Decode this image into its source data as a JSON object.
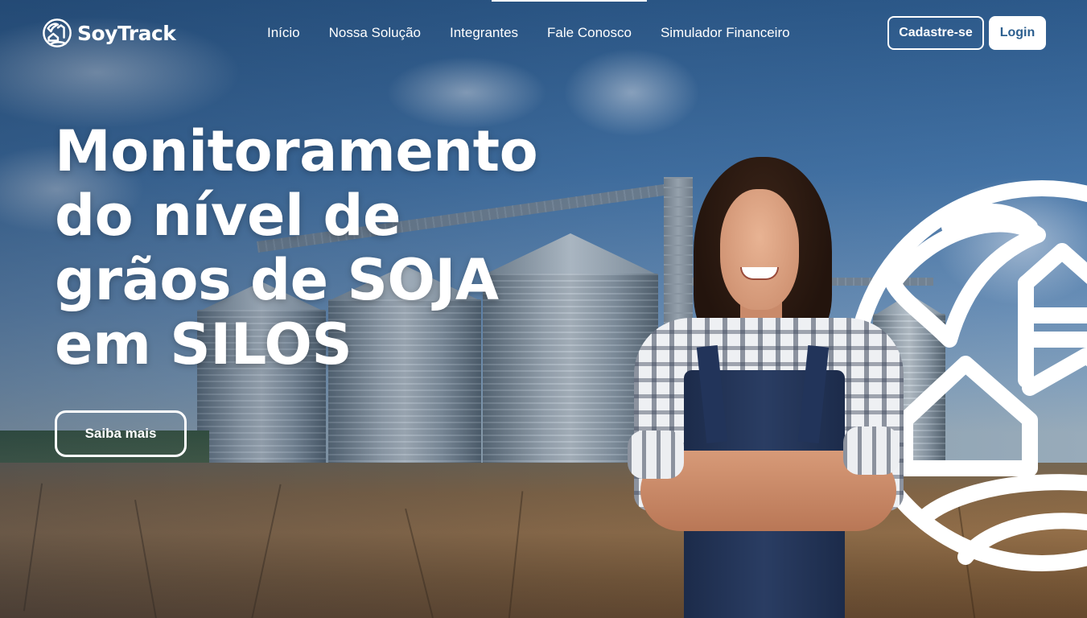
{
  "brand": {
    "name": "SoyTrack",
    "logo_icon": "farm-globe-icon"
  },
  "nav": {
    "items": [
      {
        "label": "Início"
      },
      {
        "label": "Nossa Solução"
      },
      {
        "label": "Integrantes"
      },
      {
        "label": "Fale Conosco"
      },
      {
        "label": "Simulador Financeiro"
      }
    ]
  },
  "auth": {
    "signup_label": "Cadastre-se",
    "login_label": "Login"
  },
  "hero": {
    "headline_lines": [
      "Monitoramento",
      "do nível de",
      "grãos de SOJA",
      "em SILOS"
    ],
    "cta_label": "Saiba mais",
    "decor_icon": "farm-globe-icon"
  },
  "colors": {
    "accent": "#2c5f8f",
    "text_on_hero": "#ffffff"
  }
}
